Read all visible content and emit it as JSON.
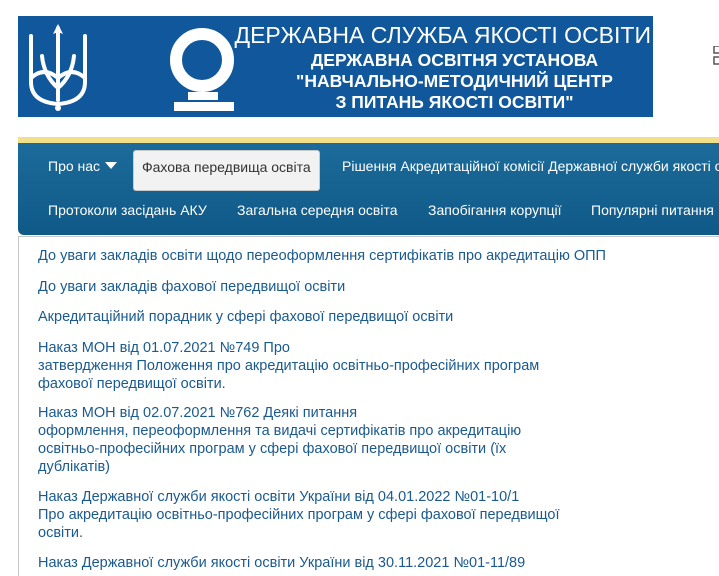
{
  "header": {
    "title": "ДЕРЖАВНА СЛУЖБА ЯКОСТІ ОСВІТИ",
    "lines": [
      "ДЕРЖАВНА ОСВІТНЯ УСТАНОВА",
      "\"НАВЧАЛЬНО-МЕТОДИЧНИЙ ЦЕНТР",
      "З ПИТАНЬ ЯКОСТІ ОСВІТИ\""
    ],
    "colors": {
      "banner": "#10589b",
      "accent_bar": "#f2df8a"
    },
    "icons": [
      "trident-emblem-icon",
      "quality-service-logo-icon"
    ]
  },
  "nav": {
    "row1": [
      {
        "label": "Про нас",
        "dropdown": true
      },
      {
        "label": "Фахова передвища освіта",
        "active": true
      },
      {
        "label": "Рішення Акредитаційної комісії Державної служби якості о"
      }
    ],
    "row2": [
      {
        "label": "Протоколи засідань АКУ"
      },
      {
        "label": "Загальна середня освіта"
      },
      {
        "label": "Запобігання корупції"
      },
      {
        "label": "Популярні питання"
      }
    ]
  },
  "content": {
    "links": [
      {
        "lines": [
          "До уваги закладів освіти щодо переоформлення сертифікатів про акредитацію ОПП"
        ]
      },
      {
        "lines": [
          "До уваги закладів фахової передвищої освіти"
        ]
      },
      {
        "lines": [
          "Акредитаційний порадник у сфері фахової передвищої освіти"
        ]
      },
      {
        "lines": [
          "Наказ МОН від 01.07.2021 №749 Про",
          "затвердження Положення про акредитацію освітньо-професійних програм",
          "фахової передвищої освіти."
        ]
      },
      {
        "lines": [
          "Наказ МОН від 02.07.2021 №762 Деякі питання",
          "оформлення, переоформлення та видачі сертифікатів про акредитацію",
          "освітньо-професійних програм у сфері фахової передвищої освіти (їх",
          "дублікатів)"
        ]
      },
      {
        "lines": [
          "Наказ Державної служби якості освіти України від 04.01.2022 №01-10/1",
          "Про акредитацію освітньо-професійних програм у сфері фахової передвищої",
          "освіти."
        ]
      },
      {
        "lines": [
          "Наказ Державної служби якості освіти України від 30.11.2021 №01-11/89"
        ]
      }
    ],
    "link_color": "#1a5a8f"
  }
}
